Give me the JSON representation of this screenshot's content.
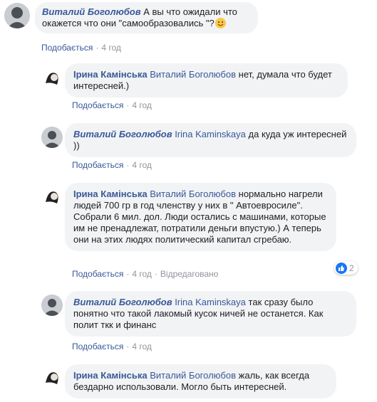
{
  "actions": {
    "like_label": "Подобається",
    "separator": "·",
    "edited_label": "Відредаговано"
  },
  "comments": [
    {
      "author": "Виталий Боголюбов",
      "text": "А вы что ожидали что окажется что они \"самообразовались \"?",
      "emoji": "smiling-face-emoji",
      "time": "4 год"
    },
    {
      "author": "Ірина Камінська",
      "mention": "Виталий Боголюбов",
      "text": "нет, думала что будет интересней.)",
      "time": "4 год"
    },
    {
      "author": "Виталий Боголюбов",
      "mention": "Irina Kaminskaya",
      "text": "да куда уж интересней ))",
      "time": "4 год"
    },
    {
      "author": "Ірина Камінська",
      "mention": "Виталий Боголюбов",
      "text": "нормально нагрели людей 700 гр в год членству у них в \" Автоевросиле\". Собрали 6 мил. дол. Люди остались с машинами, которые им не пренадлежат, потратили деньги впустую.) А теперь они на этих людях политический капитал сгребаю.",
      "time": "4 год",
      "edited": true,
      "reaction_count": "2"
    },
    {
      "author": "Виталий Боголюбов",
      "mention": "Irina Kaminskaya",
      "text": "так сразу было понятно что такой лакомый кусок ничей не останется. Как полит ткк и финанс",
      "time": "4 год"
    },
    {
      "author": "Ірина Камінська",
      "mention": "Виталий Боголюбов",
      "text": "жаль, как всегда бездарно использовали. Могло быть интересней.",
      "time": null
    }
  ]
}
